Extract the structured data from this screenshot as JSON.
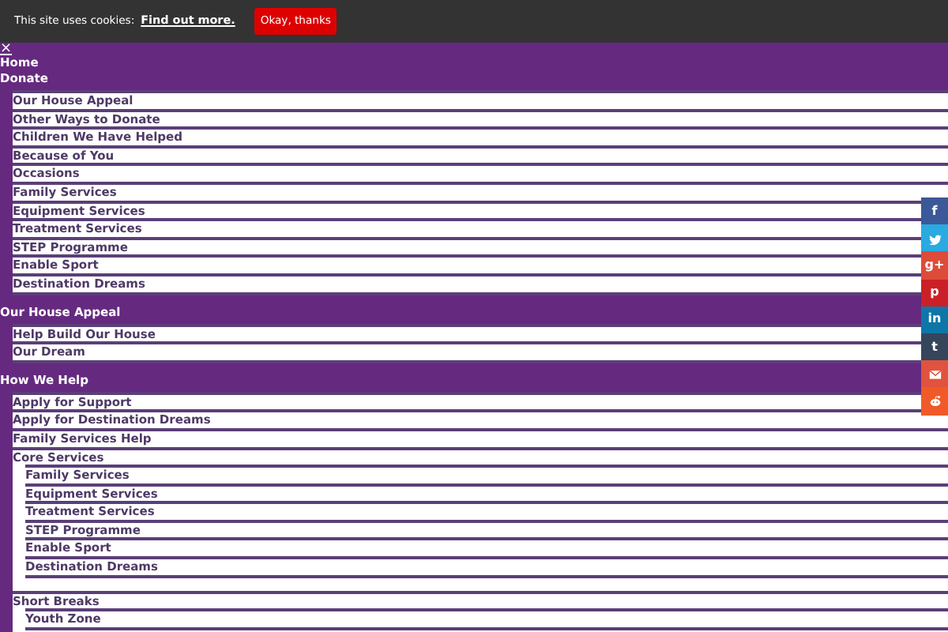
{
  "cookie_bar": {
    "message": "This site uses cookies:",
    "link": "Find out more.",
    "button": "Okay, thanks"
  },
  "menu": {
    "close": "×",
    "items": [
      {
        "label": "Home"
      },
      {
        "label": "Donate",
        "children": [
          {
            "label": "Our House Appeal"
          },
          {
            "label": "Other Ways to Donate"
          },
          {
            "label": "Children We Have Helped"
          },
          {
            "label": "Because of You"
          },
          {
            "label": "Occasions"
          },
          {
            "label": "Family Services"
          },
          {
            "label": "Equipment Services"
          },
          {
            "label": "Treatment Services"
          },
          {
            "label": "STEP Programme"
          },
          {
            "label": "Enable Sport"
          },
          {
            "label": "Destination Dreams"
          }
        ]
      },
      {
        "label": "Our House Appeal",
        "children": [
          {
            "label": "Help Build Our House"
          },
          {
            "label": "Our Dream"
          }
        ]
      },
      {
        "label": "How We Help",
        "children": [
          {
            "label": "Apply for Support"
          },
          {
            "label": "Apply for Destination Dreams"
          },
          {
            "label": "Family Services Help"
          },
          {
            "label": "Core Services",
            "children": [
              {
                "label": "Family Services"
              },
              {
                "label": "Equipment Services"
              },
              {
                "label": "Treatment Services"
              },
              {
                "label": "STEP Programme"
              },
              {
                "label": "Enable Sport"
              },
              {
                "label": "Destination Dreams"
              }
            ]
          },
          {
            "label": "Short Breaks",
            "children": [
              {
                "label": "Youth Zone"
              }
            ]
          }
        ]
      }
    ]
  },
  "share_buttons": [
    {
      "kind": "facebook",
      "glyph": "f",
      "color": "#3b5998"
    },
    {
      "kind": "twitter",
      "color": "#2ba9e1"
    },
    {
      "kind": "googleplus",
      "glyph": "g+",
      "color": "#dd4b39"
    },
    {
      "kind": "pinterest",
      "glyph": "p",
      "color": "#cb2027"
    },
    {
      "kind": "linkedin",
      "glyph": "in",
      "color": "#0e76a8"
    },
    {
      "kind": "tumblr",
      "glyph": "t",
      "color": "#35465c"
    },
    {
      "kind": "email",
      "color": "#e0533e"
    },
    {
      "kind": "reddit",
      "color": "#f05a28"
    }
  ]
}
